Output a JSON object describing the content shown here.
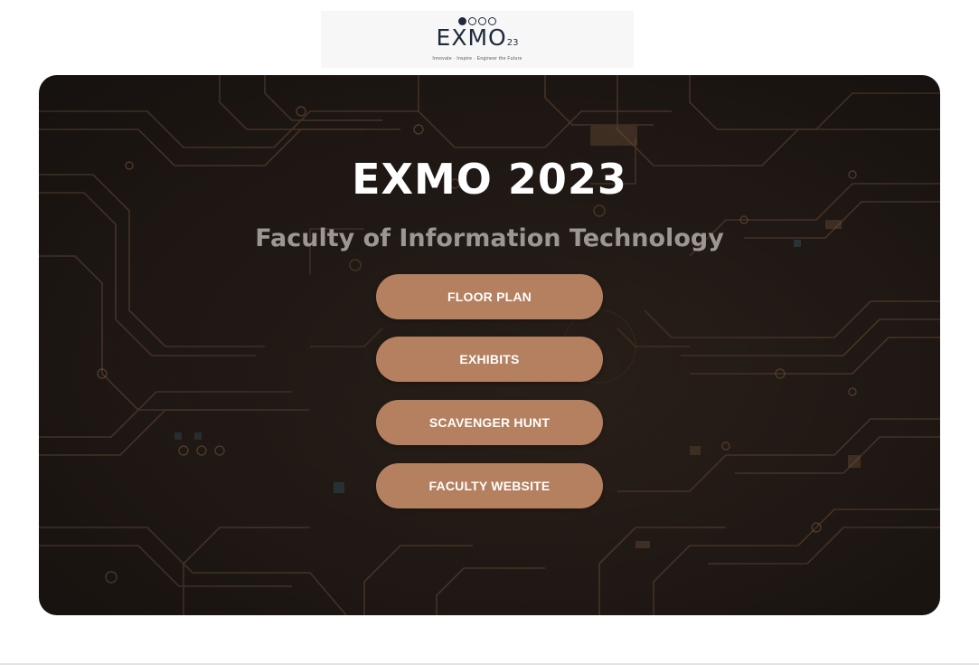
{
  "logo": {
    "word": "EXMO",
    "suffix": "23",
    "tagline": "Innovate · Inspire · Engineer the Future"
  },
  "hero": {
    "title": "EXMO 2023",
    "subtitle": "Faculty of Information Technology"
  },
  "buttons": [
    {
      "label": "FLOOR PLAN"
    },
    {
      "label": "EXHIBITS"
    },
    {
      "label": "SCAVENGER HUNT"
    },
    {
      "label": "FACULTY WEBSITE"
    }
  ],
  "colors": {
    "button": "#b4805f",
    "circuit": "#8a6446",
    "background": "#1c1613"
  }
}
